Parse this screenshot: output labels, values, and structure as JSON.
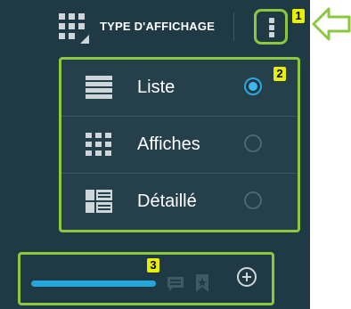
{
  "topbar": {
    "title": "TYPE D'AFFICHAGE"
  },
  "badges": {
    "b1": "1",
    "b2": "2",
    "b3": "3"
  },
  "menu": {
    "items": [
      {
        "label": "Liste",
        "icon": "list-icon",
        "selected": true
      },
      {
        "label": "Affiches",
        "icon": "grid-icon",
        "selected": false
      },
      {
        "label": "Détaillé",
        "icon": "detail-icon",
        "selected": false
      }
    ]
  },
  "bottom": {
    "progress_fraction": 1.0
  },
  "colors": {
    "panel": "#1f3a45",
    "highlight": "#8dc63f",
    "accent": "#2ba8e0",
    "badge": "#e8f000"
  }
}
